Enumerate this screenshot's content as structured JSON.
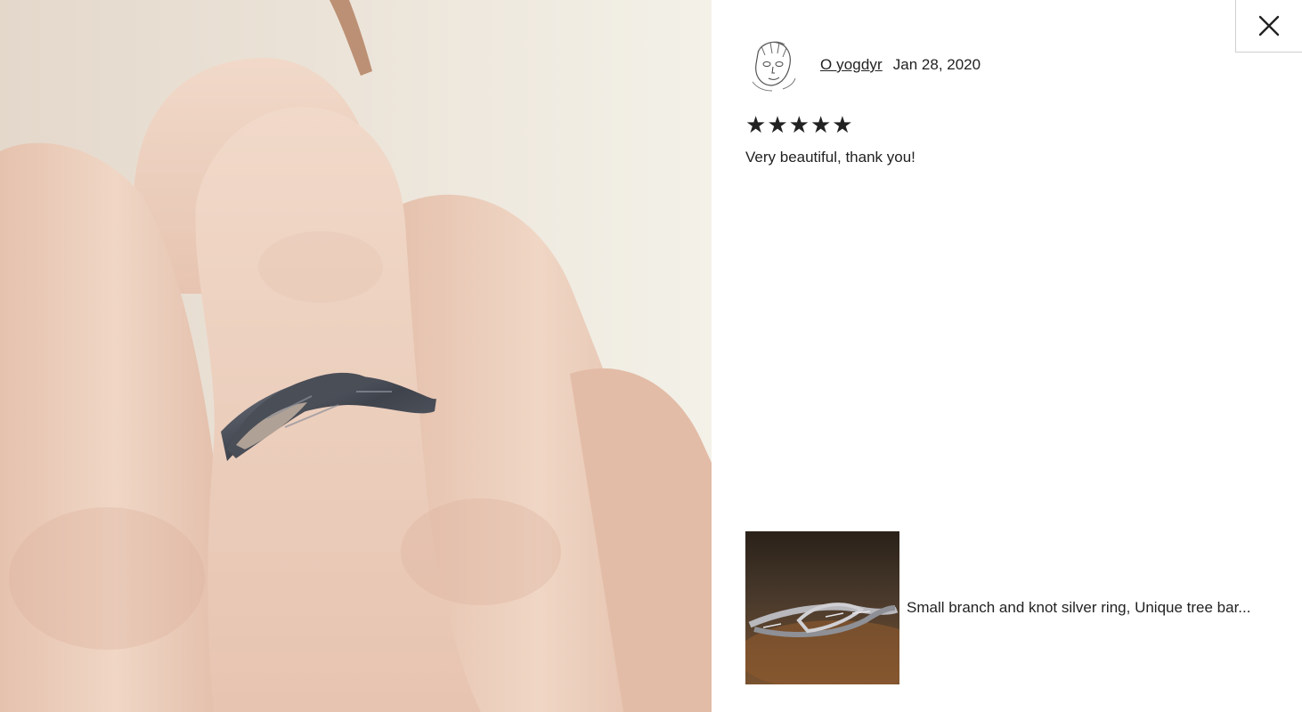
{
  "photo": {
    "description_icon": "review-photo"
  },
  "close": {
    "icon": "close-icon"
  },
  "reviewer": {
    "name": "O yogdyr",
    "date": "Jan 28, 2020",
    "avatar_icon": "avatar"
  },
  "review": {
    "rating": 5,
    "rating_max": 5,
    "stars": [
      "★",
      "★",
      "★",
      "★",
      "★"
    ],
    "text": "Very beautiful, thank you!"
  },
  "listing": {
    "title": "Small branch and knot silver ring, Unique tree bar..."
  }
}
